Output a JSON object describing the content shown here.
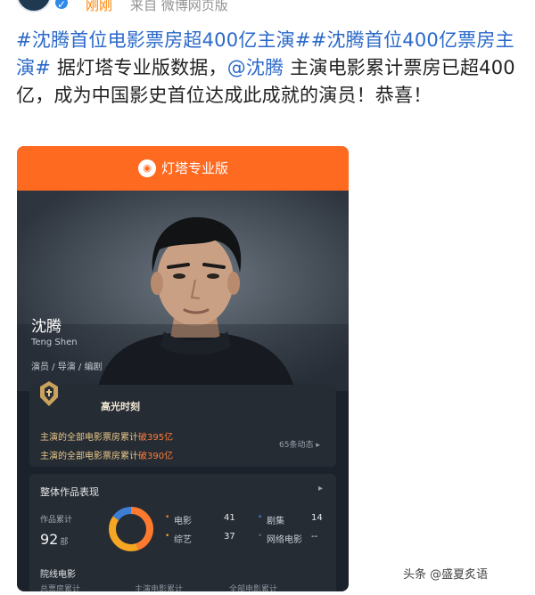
{
  "post": {
    "meta": {
      "time": "刚刚",
      "source": "来自 微博网页版"
    },
    "hashtag_1": "#沈腾首位电影票房超400亿主演#",
    "hashtag_2": "#沈腾首位400亿票房主演#",
    "body_1": " 据灯塔专业版数据，",
    "mention": "@沈腾",
    "body_2": " 主演电影累计票房已超400亿，成为中国影史首位达成此成就的演员！恭喜！"
  },
  "card": {
    "app_title": "灯塔专业版",
    "actor": {
      "name": "沈腾",
      "pinyin": "Teng Shen",
      "roles": "演员 / 导演 / 编剧"
    },
    "highlight": {
      "title": "高光时刻",
      "line_1_prefix": "主演的全部电影票房累计",
      "line_1_value": "破395亿",
      "line_2_prefix": "主演的全部电影票房累计",
      "line_2_value": "破390亿",
      "more": "65条动态 ▸"
    },
    "works": {
      "title": "整体作品表现",
      "arrow": "▸",
      "total_label": "作品累计",
      "total_value": "92",
      "total_unit": "部",
      "categories": [
        {
          "name": "电影",
          "value": "41",
          "color": "#ff7a2e"
        },
        {
          "name": "综艺",
          "value": "37",
          "color": "#f5a623"
        },
        {
          "name": "剧集",
          "value": "14",
          "color": "#3d7fd6"
        },
        {
          "name": "网络电影",
          "value": "--",
          "color": "#5d6670"
        }
      ],
      "cinema_title": "院线电影",
      "cinema_subs": [
        "总票房累计",
        "主演电影累计",
        "全部电影累计"
      ]
    }
  },
  "watermark": "头条 @盛夏炙语"
}
